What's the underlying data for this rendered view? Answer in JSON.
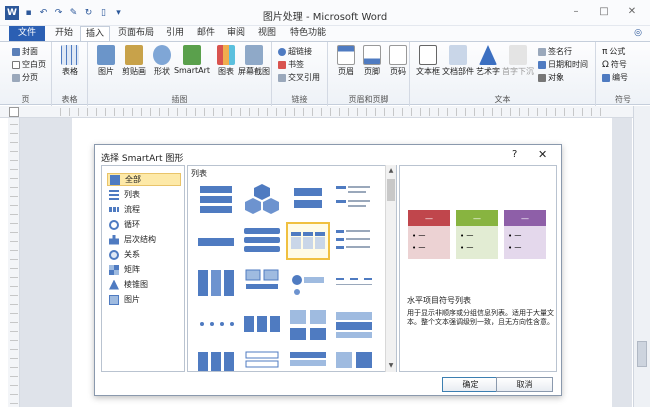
{
  "window": {
    "title": "图片处理 - Microsoft Word",
    "logo": "W",
    "qat_icons": [
      "save-icon",
      "undo-icon",
      "redo-icon",
      "format-painter-icon",
      "refresh-icon",
      "new-doc-icon",
      "customize-qat-icon"
    ],
    "controls": [
      "–",
      "□",
      "✕"
    ]
  },
  "tabs": [
    "文件",
    "开始",
    "插入",
    "页面布局",
    "引用",
    "邮件",
    "审阅",
    "视图",
    "特色功能"
  ],
  "ribbon": {
    "pages": {
      "label": "页",
      "items": [
        "封面",
        "空白页",
        "分页"
      ]
    },
    "tables": {
      "label": "表格",
      "button": "表格"
    },
    "illustrations": {
      "label": "插图",
      "buttons": [
        "图片",
        "剪贴画",
        "形状",
        "SmartArt",
        "图表",
        "屏幕截图"
      ]
    },
    "links": {
      "label": "链接",
      "items": [
        "超链接",
        "书签",
        "交叉引用"
      ]
    },
    "header_footer": {
      "label": "页眉和页脚",
      "buttons": [
        "页眉",
        "页脚",
        "页码"
      ]
    },
    "text": {
      "label": "文本",
      "buttons": [
        "文本框",
        "文档部件",
        "艺术字",
        "首字下沉"
      ],
      "items": [
        "签名行",
        "日期和时间",
        "对象"
      ]
    },
    "symbols": {
      "label": "符号",
      "items": [
        "公式",
        "符号",
        "编号"
      ]
    }
  },
  "dialog": {
    "title": "选择 SmartArt 图形",
    "help": "?",
    "close": "✕",
    "categories": [
      "全部",
      "列表",
      "流程",
      "循环",
      "层次结构",
      "关系",
      "矩阵",
      "棱锥图",
      "图片"
    ],
    "selected_category": "全部",
    "gallery_title": "列表",
    "preview_name": "水平项目符号列表",
    "preview_desc": "用于显示非顺序或分组信息列表。适用于大量文本。整个文本强调级别一致，且无方向性含意。",
    "preview_bullets": [
      "• 一",
      "• 一"
    ],
    "ok": "确定",
    "cancel": "取消"
  },
  "colors": {
    "file_tab": "#2b5fb3",
    "preview_red": "#c0464c",
    "preview_green": "#88b440",
    "preview_purple": "#8e5fa8",
    "smartart_blue": "#4f7bc1"
  }
}
